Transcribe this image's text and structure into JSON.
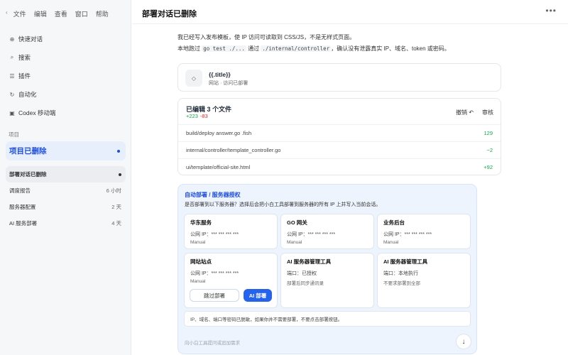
{
  "menubar": {
    "back": "‹",
    "items": [
      "文件",
      "编辑",
      "查看",
      "窗口",
      "帮助"
    ]
  },
  "nav": [
    {
      "icon": "new-chat-icon",
      "glyph": "⊕",
      "label": "快速对话"
    },
    {
      "icon": "search-icon",
      "glyph": "⌕",
      "label": "搜索"
    },
    {
      "icon": "plugins-icon",
      "glyph": "☰",
      "label": "插件"
    },
    {
      "icon": "automation-icon",
      "glyph": "↻",
      "label": "自动化"
    },
    {
      "icon": "codex-icon",
      "glyph": "▣",
      "label": "Codex 移动端"
    }
  ],
  "projects_label": "项目",
  "project": {
    "name": "项目已删除"
  },
  "conversations": [
    {
      "title": "部署对话已删除",
      "time": "",
      "active": true
    },
    {
      "title": "调度报告",
      "time": "6 小时"
    },
    {
      "title": "服务器配置",
      "time": "2 天"
    },
    {
      "title": "AI 服务部署",
      "time": "4 天"
    }
  ],
  "header": {
    "title": "部署对话已删除",
    "more": "•••"
  },
  "message": {
    "line1": "我已经写入发布模板，使 IP 访问可读取到 CSS/JS，不是无样式页面。",
    "line2_prefix": "本地跑过 ",
    "line2_code": "go test ./...",
    "line2_mid": " 通过 ",
    "line2_code2": "./internal/controller",
    "line2_suffix": "，确认没有泄露真实 IP、域名、token 或密码。"
  },
  "task": {
    "name": "{{.title}}",
    "sub": "网站 · 访问已部署",
    "icon_glyph": "◇"
  },
  "diff": {
    "heading": "已编辑 3 个文件",
    "added": "+223",
    "removed": "-83",
    "undo_label": "撤销 ↶",
    "review_label": "审核",
    "files": [
      {
        "path": "build/deploy answer.go .fish",
        "delta": "129"
      },
      {
        "path": "internal/controller/template_controller.go",
        "delta": "−2"
      },
      {
        "path": "ui/template/official-site.html",
        "delta": "+92"
      }
    ]
  },
  "panel": {
    "title": "自动部署 / 服务器授权",
    "desc": "是否部署到以下服务器？选择后会把小白工具部署到服务器的所有 IP 上并写入当前会话。",
    "servers": [
      {
        "name": "华东服务",
        "line1": "公网 IP：*** *** *** ***",
        "line2": "Manual"
      },
      {
        "name": "GO 网关",
        "line1": "公网 IP：*** *** *** ***",
        "line2": "Manual"
      },
      {
        "name": "业务后台",
        "line1": "公网 IP：*** *** *** ***",
        "line2": "Manual"
      },
      {
        "name": "网站站点",
        "line1": "公网 IP：*** *** *** ***",
        "line2": "Manual"
      },
      {
        "name": "AI 服务器管理工具",
        "line1": "端口：已授权",
        "line2": "部署后同步通讯录"
      },
      {
        "name": "AI 服务器管理工具",
        "line1": "端口：本地执行",
        "line2": "不要求部署到全部"
      }
    ],
    "btn_ghost": "跳过部署",
    "btn_primary": "AI 部署",
    "notice": "IP、域名、端口等密码已脱敏，如果你并不需要部署，不要点击部署按钮。",
    "placeholder": "向小白工具提问或追加需求",
    "send_glyph": "↓"
  },
  "colors": {
    "accent": "#2563eb",
    "add": "#16a34a",
    "del": "#dc2626"
  }
}
